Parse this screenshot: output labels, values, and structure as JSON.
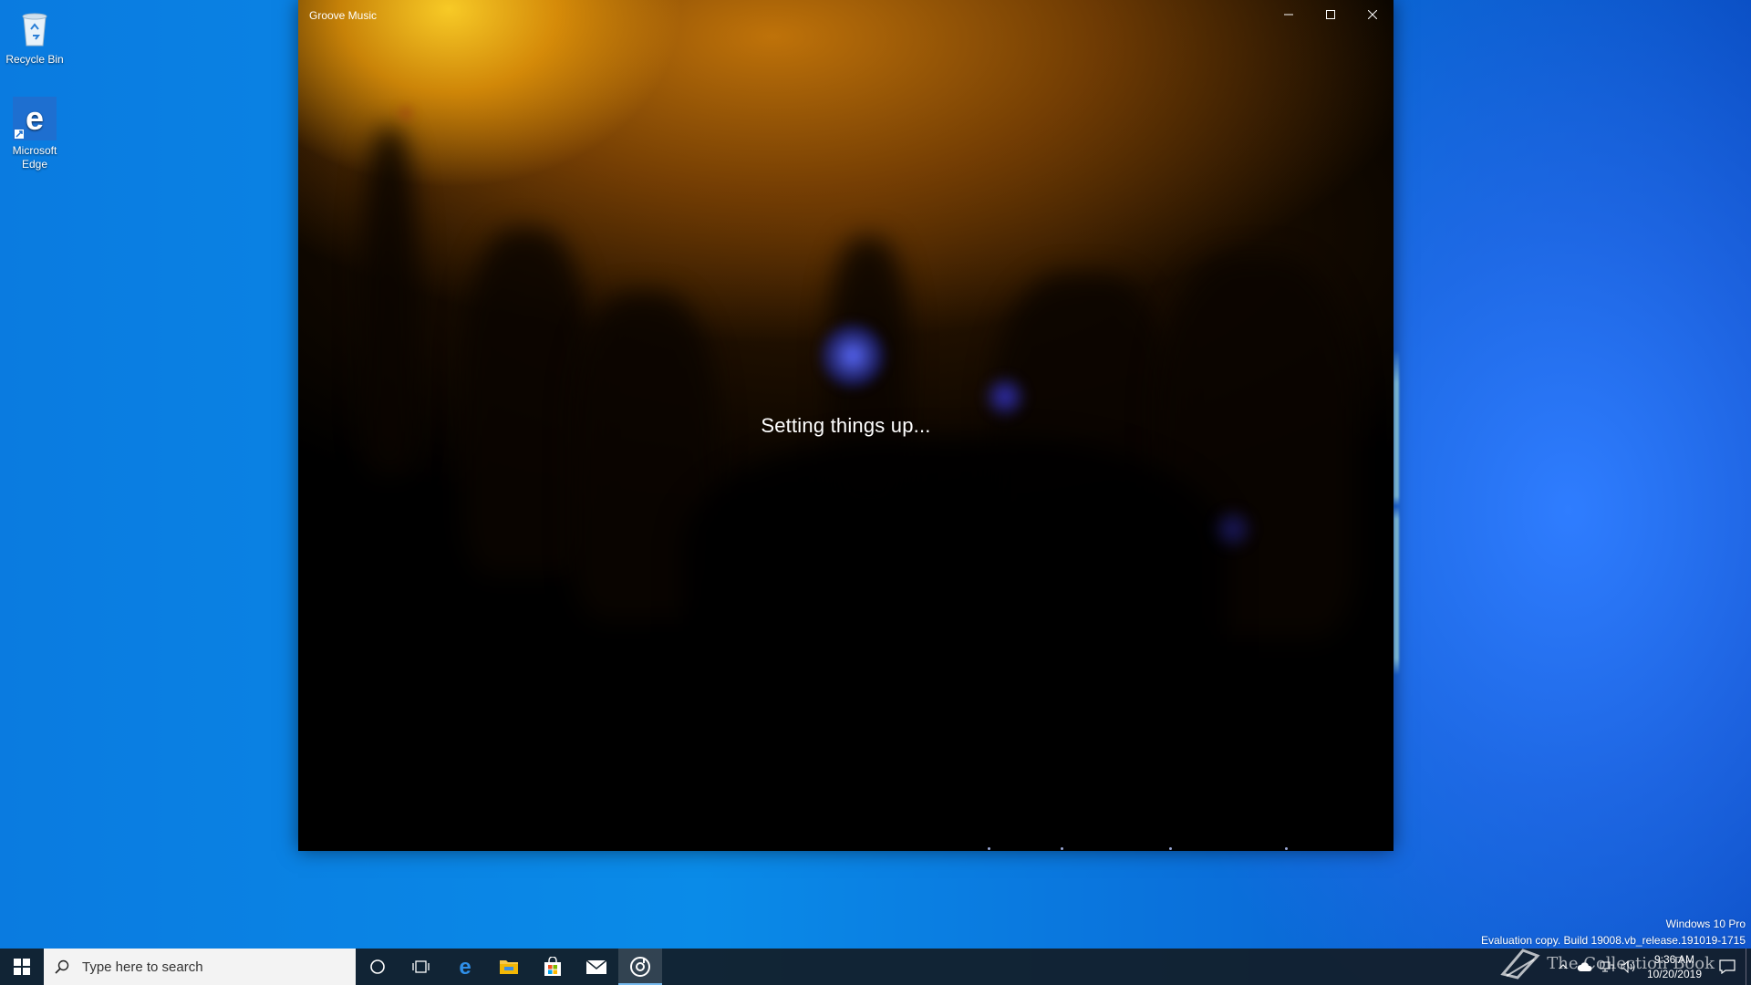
{
  "desktop": {
    "icons": [
      {
        "label": "Recycle Bin",
        "icon": "recycle-bin-icon"
      },
      {
        "label": "Microsoft Edge",
        "icon": "edge-icon"
      }
    ],
    "watermark": {
      "line1": "Windows 10 Pro",
      "line2": "Evaluation copy. Build 19008.vb_release.191019-1715"
    }
  },
  "window": {
    "title": "Groove Music",
    "status_text": "Setting things up...",
    "controls": {
      "minimize": "minimize-icon",
      "maximize": "maximize-icon",
      "close": "close-icon"
    }
  },
  "taskbar": {
    "search_placeholder": "Type here to search",
    "pinned": [
      "start-icon",
      "cortana-icon",
      "task-view-icon",
      "edge-icon",
      "file-explorer-icon",
      "store-icon",
      "mail-icon",
      "groove-music-icon"
    ],
    "active_app": "groove-music-icon",
    "clock": {
      "time": "9:36 AM",
      "date": "10/20/2019"
    },
    "overlay_brand": "The Collection Book"
  },
  "colors": {
    "desktop_blue": "#0a7be0",
    "taskbar": "#121c26",
    "active_indicator": "#76b9ed"
  }
}
